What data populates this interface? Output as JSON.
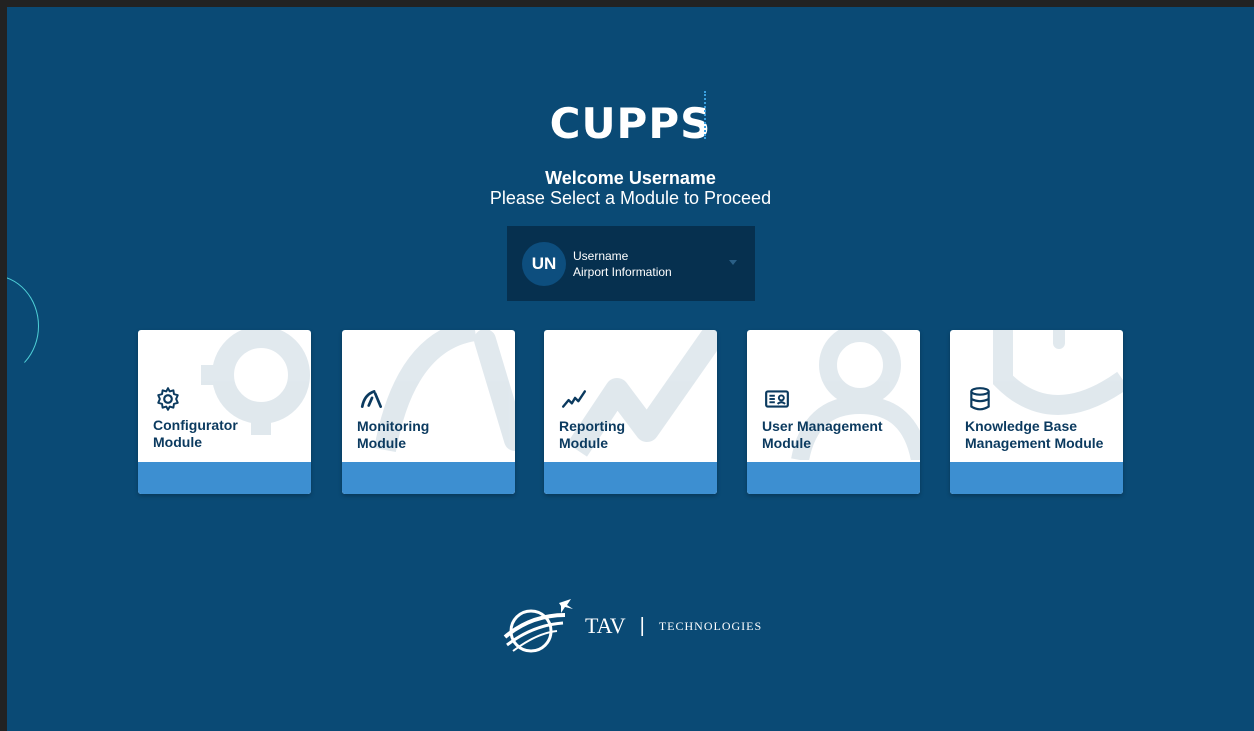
{
  "app": {
    "logo_text": "CUPPS"
  },
  "welcome": {
    "title": "Welcome Username",
    "subtitle": "Please Select a Module to Proceed"
  },
  "user": {
    "initials": "UN",
    "name": "Username",
    "info": "Airport Information"
  },
  "modules": [
    {
      "label_line1": "Configurator",
      "label_line2": "Module",
      "icon": "gear-icon"
    },
    {
      "label_line1": "Monitoring",
      "label_line2": "Module",
      "icon": "gauge-icon"
    },
    {
      "label_line1": "Reporting",
      "label_line2": "Module",
      "icon": "trend-icon"
    },
    {
      "label_line1": "User Management",
      "label_line2": "Module",
      "icon": "id-card-icon"
    },
    {
      "label_line1": "Knowledge Base",
      "label_line2": "Management Module",
      "icon": "database-icon"
    }
  ],
  "footer": {
    "brand": "TAV",
    "brand_suffix": "TECHNOLOGIES"
  },
  "colors": {
    "background": "#0a4a75",
    "panel": "#06304f",
    "accent": "#3d8fd1",
    "card": "#ffffff",
    "text_dark": "#0b3a5f"
  }
}
